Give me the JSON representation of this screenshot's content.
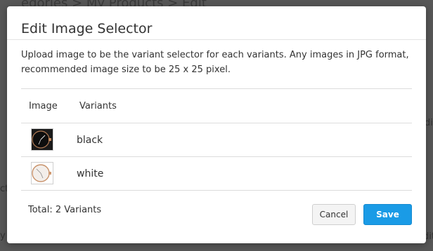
{
  "background": {
    "breadcrumb": "egories > My Products > Edit",
    "fragments": [
      "ct",
      "y",
      "di",
      "dit"
    ]
  },
  "modal": {
    "title": "Edit Image Selector",
    "description": "Upload image to be the variant selector for each variants. Any images in JPG format, recommended image size to be 25 x 25 pixel.",
    "table": {
      "headers": {
        "image": "Image",
        "variants": "Variants"
      },
      "rows": [
        {
          "thumbnail": "watch-black-thumbnail",
          "variant": "black"
        },
        {
          "thumbnail": "watch-white-thumbnail",
          "variant": "white"
        }
      ]
    },
    "total": "Total: 2 Variants",
    "buttons": {
      "cancel": "Cancel",
      "save": "Save"
    }
  },
  "colors": {
    "accent": "#1a9be6",
    "overlay": "#575757"
  }
}
